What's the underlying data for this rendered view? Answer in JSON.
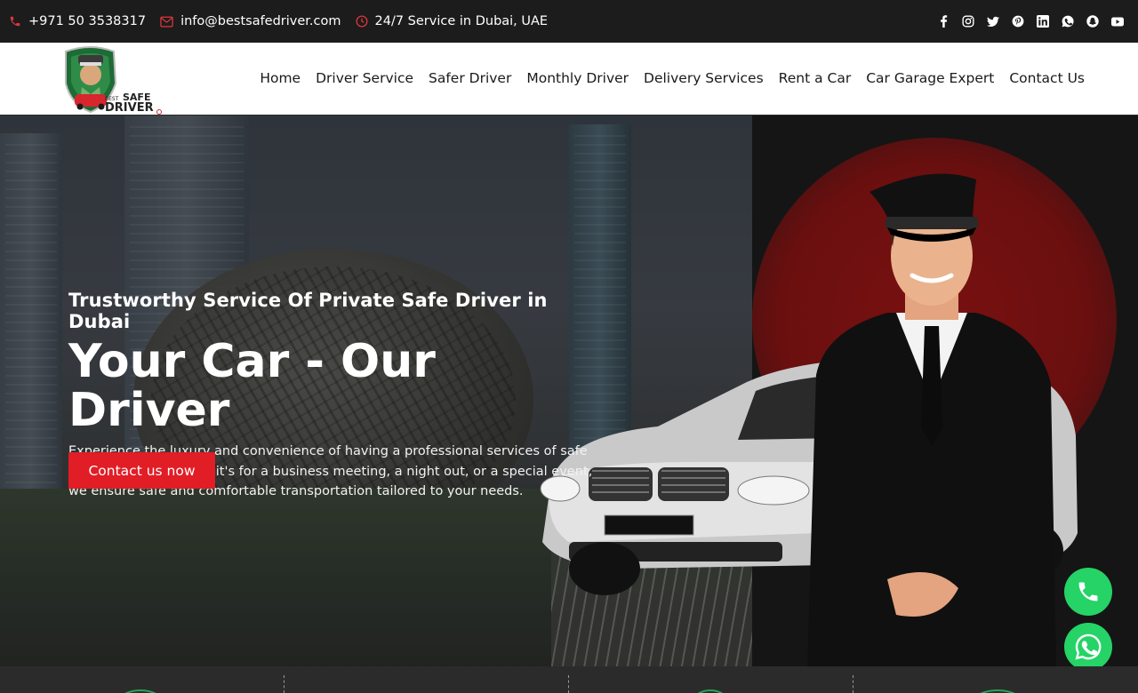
{
  "topbar": {
    "phone": "+971 50 3538317",
    "email": "info@bestsafedriver.com",
    "hours": "24/7 Service in Dubai, UAE",
    "phone_icon": "phone-icon",
    "email_icon": "envelope-icon",
    "clock_icon": "clock-icon",
    "socials": [
      "facebook-icon",
      "instagram-icon",
      "twitter-icon",
      "pinterest-icon",
      "linkedin-icon",
      "whatsapp-icon",
      "snapchat-icon",
      "youtube-icon"
    ]
  },
  "header": {
    "logo_text_top": "BEST",
    "logo_text_safe": "SAFE",
    "logo_text_driver": "DRIVER",
    "nav": [
      "Home",
      "Driver Service",
      "Safer Driver",
      "Monthly Driver",
      "Delivery Services",
      "Rent a Car",
      "Car Garage Expert",
      "Contact Us"
    ]
  },
  "hero": {
    "subtitle": "Trustworthy Service Of Private Safe Driver in Dubai",
    "title": "Your Car - Our Driver",
    "description": "Experience the luxury and convenience of having a professional services of safe driver Dubai. Whether it's for a business meeting, a night out, or a special event, we ensure safe and comfortable transportation tailored to your needs.",
    "cta": "Contact us now"
  },
  "floating": {
    "call_icon": "phone-call-icon",
    "whatsapp_icon": "whatsapp-chat-icon"
  },
  "colors": {
    "accent": "#e11d26",
    "topbar": "#1c1c1c",
    "whatsapp": "#25d366"
  }
}
